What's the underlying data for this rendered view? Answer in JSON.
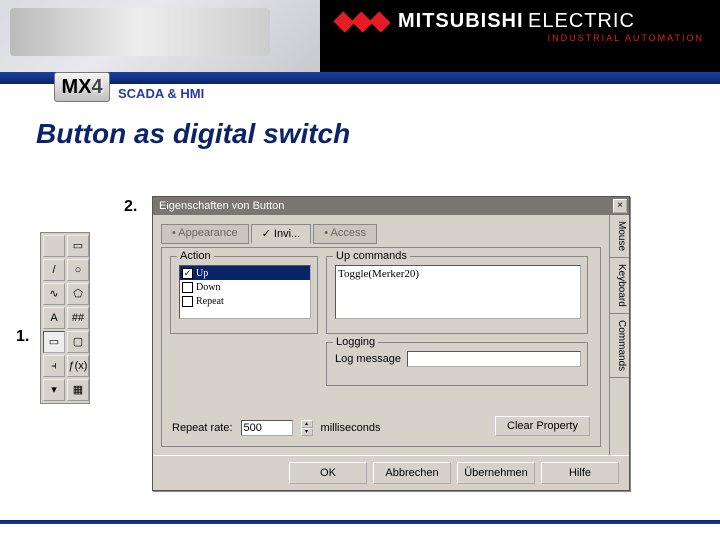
{
  "brand": {
    "name1": "MITSUBISHI",
    "name2": "ELECTRIC",
    "subline": "INDUSTRIAL AUTOMATION"
  },
  "product": {
    "mx": "MX",
    "four": "4",
    "tagline": "SCADA & HMI"
  },
  "slide_title": "Button as digital switch",
  "steps": {
    "one": "1.",
    "two": "2."
  },
  "toolbox": {
    "items": [
      {
        "name": "pointer-icon",
        "glyph": ""
      },
      {
        "name": "select-icon",
        "glyph": "▭"
      },
      {
        "name": "line-icon",
        "glyph": "/"
      },
      {
        "name": "ellipse-icon",
        "glyph": "○"
      },
      {
        "name": "curve-icon",
        "glyph": "∿"
      },
      {
        "name": "polygon-icon",
        "glyph": "⬠"
      },
      {
        "name": "text-icon",
        "glyph": "A"
      },
      {
        "name": "hash-icon",
        "glyph": "##"
      },
      {
        "name": "button-icon",
        "glyph": "▭"
      },
      {
        "name": "display-icon",
        "glyph": "▢"
      },
      {
        "name": "chart-icon",
        "glyph": "⫞"
      },
      {
        "name": "fx-icon",
        "glyph": "ƒ(x)"
      },
      {
        "name": "down-icon",
        "glyph": "▾"
      },
      {
        "name": "grid-icon",
        "glyph": "▦"
      }
    ],
    "active_index": 8
  },
  "dialog": {
    "title": "Eigenschaften von Button",
    "tabs": [
      "Appearance",
      "Invi...",
      "Access"
    ],
    "active_tab": 1,
    "action": {
      "label": "Action",
      "items": [
        {
          "label": "Up",
          "checked": true,
          "selected": true
        },
        {
          "label": "Down",
          "checked": false,
          "selected": false
        },
        {
          "label": "Repeat",
          "checked": false,
          "selected": false
        }
      ]
    },
    "upcommands": {
      "label": "Up commands",
      "value": "Toggle(Merker20)"
    },
    "logging": {
      "label": "Logging",
      "field_label": "Log message",
      "value": ""
    },
    "repeat": {
      "label": "Repeat rate:",
      "value": "500",
      "unit": "milliseconds"
    },
    "clear": "Clear Property",
    "sidebar": [
      "Mouse",
      "Keyboard",
      "Commands"
    ],
    "buttons": [
      "OK",
      "Abbrechen",
      "Übernehmen",
      "Hilfe"
    ]
  }
}
